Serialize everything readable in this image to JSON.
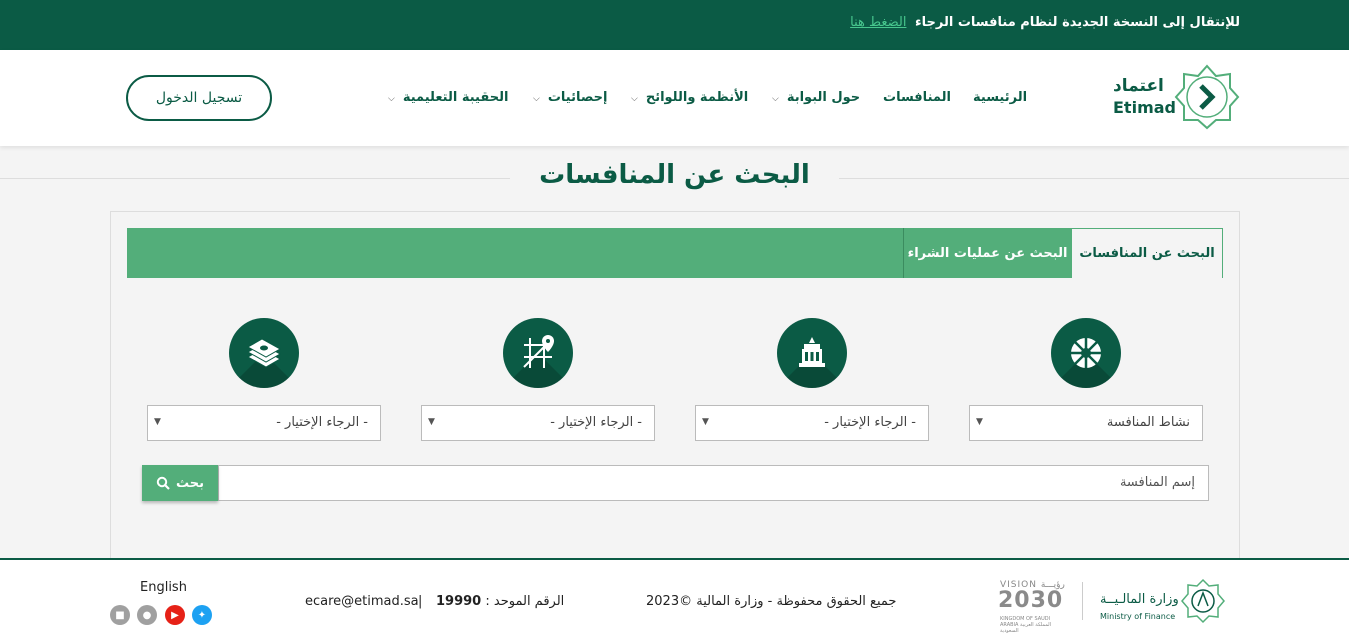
{
  "topbar": {
    "message": "للإنتقال إلى النسخة الجديدة لنظام منافسات الرجاء",
    "link": "الضغط هنا"
  },
  "header": {
    "logo_ar": "اعتماد",
    "logo_en": "Etimad",
    "nav": {
      "home": "الرئيسية",
      "competitions": "المنافسات",
      "about": "حول البوابة",
      "regulations": "الأنظمة واللوائح",
      "statistics": "إحصائيات",
      "education": "الحقيبة التعليمية"
    },
    "login": "تسجيل الدخول"
  },
  "page_title": "البحث عن المنافسات",
  "tabs": {
    "competitions": "البحث عن المنافسات",
    "purchases": "البحث عن عمليات الشراء"
  },
  "filters": {
    "activity": "نشاط المنافسة",
    "placeholder": "- الرجاء الإختيار -"
  },
  "search": {
    "placeholder": "إسم المنافسة",
    "button": "بحث"
  },
  "footer": {
    "copyright": "جميع الحقوق محفوظة - وزارة المالية ©2023",
    "unified_label": "الرقم الموحد :",
    "unified_number": "19990",
    "separator": "|",
    "email": "ecare@etimad.sa",
    "language": "English",
    "vision_small": "VISION رؤيـــة",
    "vision_year": "2030",
    "vision_caption": "KINGDOM OF SAUDI ARABIA المملكة العربية السعودية",
    "ministry_ar": "وزارة المالـيــة",
    "ministry_en": "Ministry of Finance"
  },
  "colors": {
    "primary": "#0b5b45",
    "accent": "#53ae7a",
    "link": "#48c78e"
  }
}
